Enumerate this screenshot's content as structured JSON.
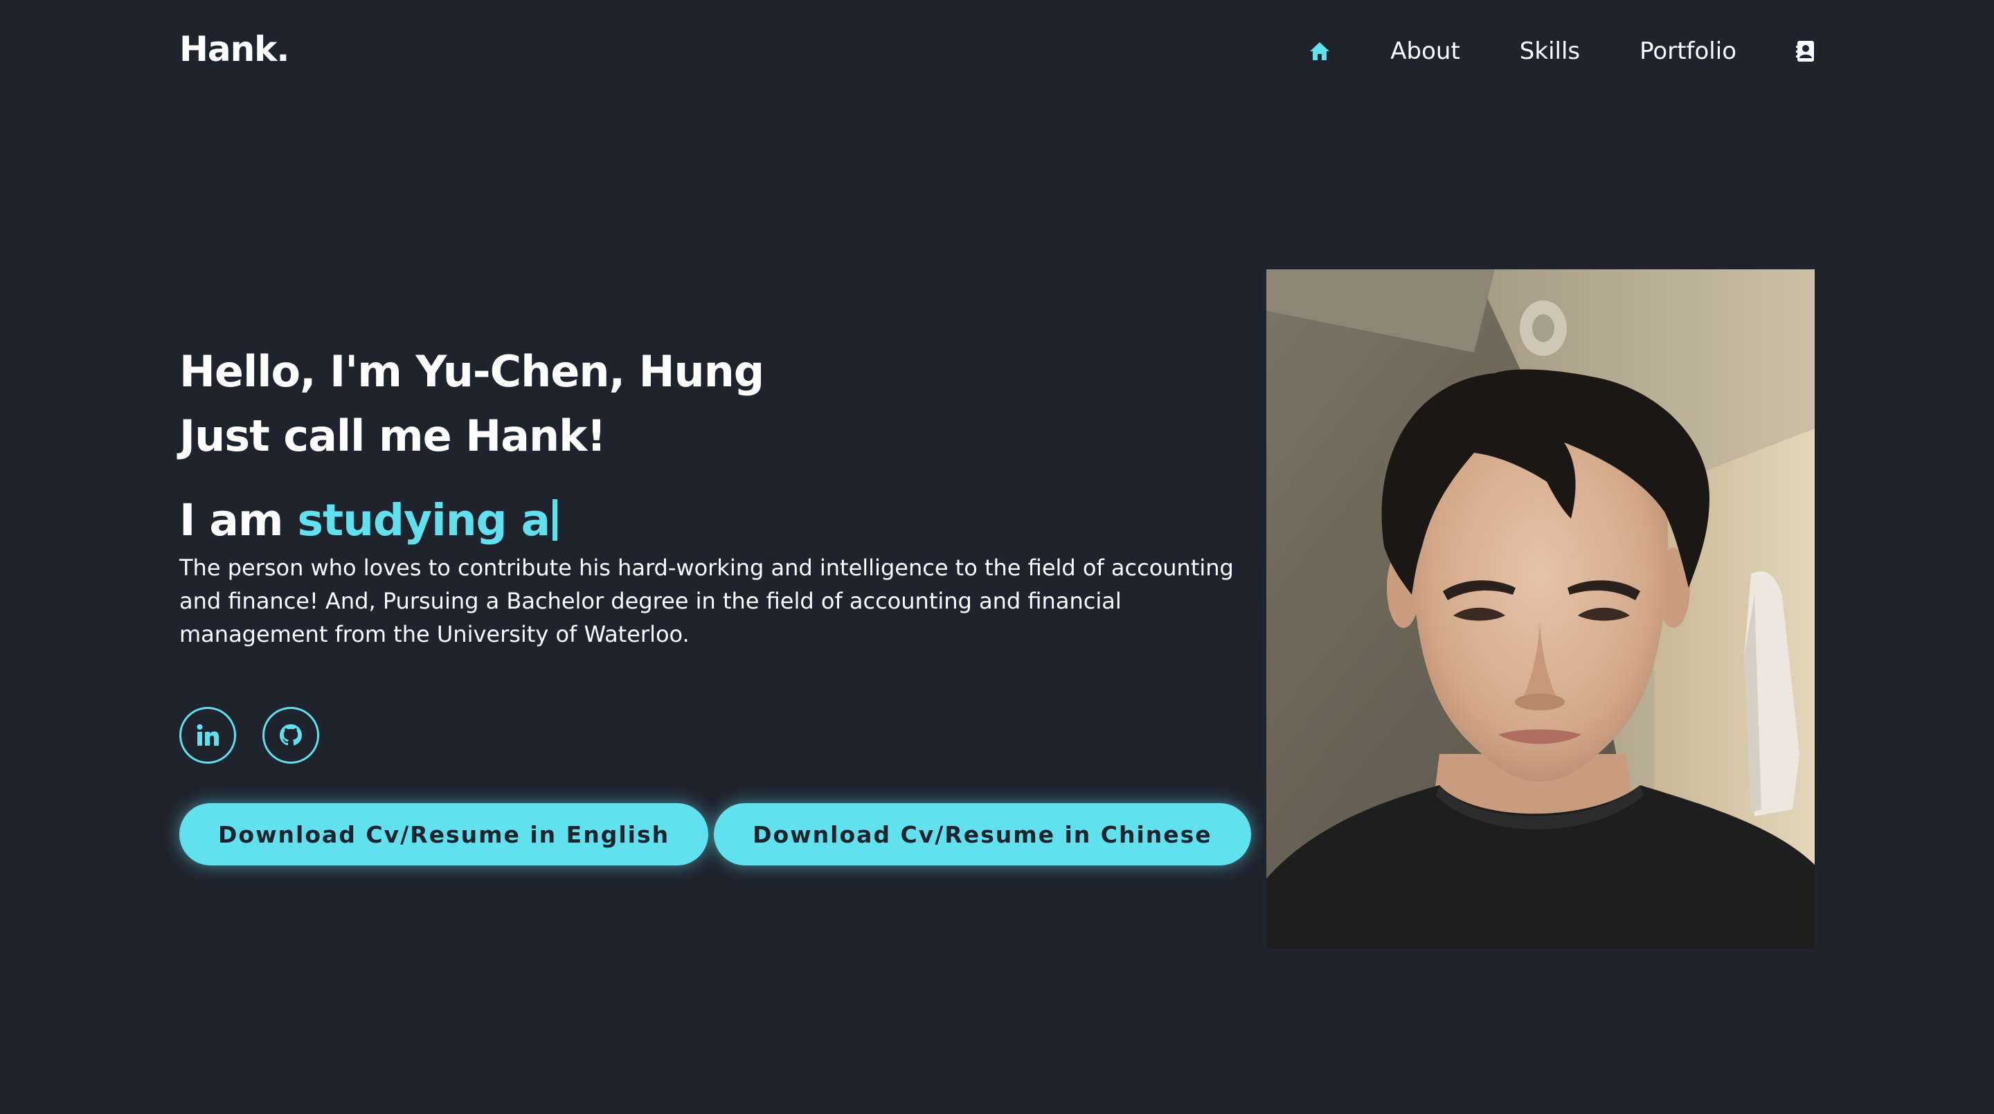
{
  "header": {
    "logo": "Hank.",
    "nav": {
      "home_icon": "home-icon",
      "items": [
        {
          "label": "About"
        },
        {
          "label": "Skills"
        },
        {
          "label": "Portfolio"
        }
      ],
      "contact_icon": "contact-card-icon"
    }
  },
  "hero": {
    "title_line_1": "Hello, I'm Yu-Chen, Hung",
    "title_line_2": "Just call me Hank!",
    "typing_prefix": "I am ",
    "typing_text": "studying a",
    "description": "The person who loves to contribute his hard-working and intelligence to the field of accounting and finance! And, Pursuing a Bachelor degree in the field of accounting and financial management from the University of Waterloo.",
    "socials": [
      {
        "icon": "linkedin-icon"
      },
      {
        "icon": "github-icon"
      }
    ],
    "buttons": {
      "english": "Download Cv/Resume in English",
      "chinese": "Download Cv/Resume in Chinese"
    }
  },
  "portrait": {
    "icon": "profile-photo"
  },
  "colors": {
    "background": "#1f232d",
    "accent": "#61e0ee",
    "text": "#ffffff"
  }
}
